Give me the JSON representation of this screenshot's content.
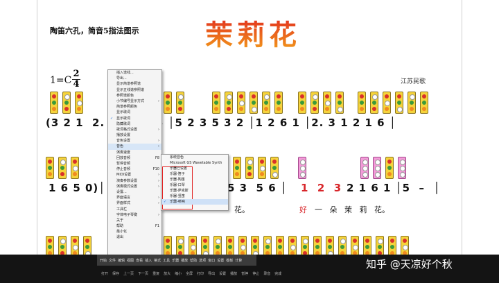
{
  "sheet": {
    "subtitle": "陶笛六孔，简音5指法图示",
    "title": "茉莉花",
    "key": "1=C",
    "time_top": "2",
    "time_bottom": "4",
    "origin": "江苏民歌",
    "row1_notes": "(3 2 1  2.         6 5 │5 2 3 5 3 2 │1 2 6 1 │2. 3 1 2 1 6 │",
    "row2_notes_left": "1 6 5 0)│",
    "row2_notes_mid": "5 3  5 6 │",
    "row2_notes_red": "1  2  3",
    "row2_notes_right": "2 1 6 1 │5  –  │",
    "lyrics_left": "花。",
    "lyrics_right_red": "好",
    "lyrics_right": "一   朵   茉   莉   花。"
  },
  "context_menu": {
    "items": [
      {
        "label": "插入谱线..."
      },
      {
        "label": "导出..."
      },
      {
        "label": "显示简谱参照谱"
      },
      {
        "label": "显示五线谱参照谱"
      },
      {
        "label": "参照谱颜色"
      },
      {
        "label": "小节编号显示方式",
        "arrow": "›"
      },
      {
        "label": "简谱参照颜色"
      },
      {
        "label": "显示歌词"
      },
      {
        "label": "显示歌词",
        "checked": true
      },
      {
        "label": "隐藏歌词"
      },
      {
        "label": "歌词格式设置",
        "arrow": "›"
      },
      {
        "label": "播放设置"
      },
      {
        "label": "音色设置",
        "arrow": "›"
      },
      {
        "label": "音色",
        "arrow": "›",
        "active": true
      },
      {
        "label": "演奏速度"
      },
      {
        "label": "回放音频",
        "key": "F8"
      },
      {
        "label": "暂停音频"
      },
      {
        "label": "停止音频",
        "key": "F10"
      },
      {
        "label": "MIDI设置",
        "arrow": "›"
      },
      {
        "label": "演奏参数设置",
        "arrow": "›"
      },
      {
        "label": "演奏模式设置",
        "arrow": "›"
      },
      {
        "label": "设置..."
      },
      {
        "label": "界面语言",
        "arrow": "›"
      },
      {
        "label": "界面样式",
        "arrow": "›"
      },
      {
        "label": "工具栏"
      },
      {
        "label": "字体电子琴键",
        "arrow": "›"
      },
      {
        "label": "关于"
      },
      {
        "label": "帮助",
        "key": "F1"
      },
      {
        "label": "最小化"
      },
      {
        "label": "退出"
      }
    ]
  },
  "submenu": {
    "items": [
      {
        "label": "系统音色"
      },
      {
        "label": "Microsoft GS Wavetable Synth"
      },
      {
        "label": "乐器已设置"
      },
      {
        "label": "乐器-笛子"
      },
      {
        "label": "乐器-陶笛"
      },
      {
        "label": "乐器-口琴"
      },
      {
        "label": "乐器-萨克斯"
      },
      {
        "label": "乐器-竖笛"
      },
      {
        "label": "乐器-唢呐",
        "checked": true,
        "active": true
      }
    ]
  },
  "taskbar": {
    "top_labels": [
      "开始",
      "文件",
      "编辑",
      "视图",
      "查看",
      "插入",
      "格式",
      "工具",
      "乐器",
      "播放",
      "帮助",
      "选项",
      "窗口",
      "设置",
      "模板",
      "计算"
    ],
    "bottom_labels": [
      "打开",
      "保存",
      "上一页",
      "下一页",
      "重复",
      "放大",
      "缩小",
      "全屏",
      "打印",
      "导出",
      "设置",
      "播放",
      "暂停",
      "停止",
      "录音",
      "完成"
    ]
  },
  "watermark": "知乎 @天凉好个秋"
}
